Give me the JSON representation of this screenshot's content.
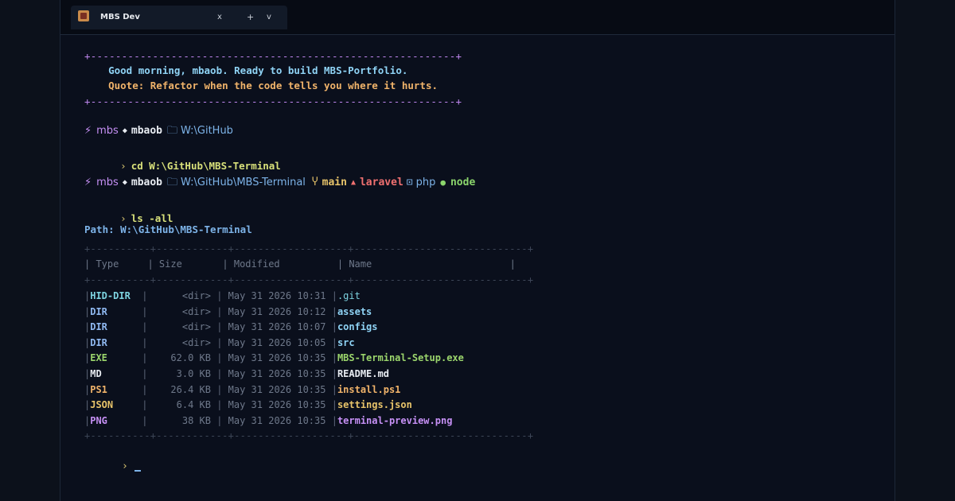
{
  "tab": {
    "title": "MBS Dev",
    "close": "x",
    "new_tab": "+",
    "dropdown": "v"
  },
  "banner": {
    "border": "+-----------------------------------------------------------+",
    "greeting": "    Good morning, mbaob. Ready to build MBS-Portfolio.",
    "quote": "    Quote: Refactor when the code tells you where it hurts."
  },
  "prompt1": {
    "distro": "mbs",
    "user": "mbaob",
    "path": "W:\\GitHub",
    "command": "cd W:\\GitHub\\MBS-Terminal"
  },
  "prompt2": {
    "distro": "mbs",
    "user": "mbaob",
    "path": "W:\\GitHub\\MBS-Terminal",
    "branch": "main",
    "framework": "laravel",
    "lang": "php",
    "runtime": "node",
    "command": "ls -all"
  },
  "listing": {
    "path_line": "Path: W:\\GitHub\\MBS-Terminal",
    "border": "+----------+------------+-------------------+-----------------------------+",
    "header": "| Type     | Size       | Modified          | Name                        |",
    "rows": [
      {
        "type": "HID-DIR",
        "size": "     <dir>",
        "modified": "May 31 2026 10:31",
        "name": ".git"
      },
      {
        "type": "DIR",
        "size": "     <dir>",
        "modified": "May 31 2026 10:12",
        "name": "assets"
      },
      {
        "type": "DIR",
        "size": "     <dir>",
        "modified": "May 31 2026 10:07",
        "name": "configs"
      },
      {
        "type": "DIR",
        "size": "     <dir>",
        "modified": "May 31 2026 10:05",
        "name": "src"
      },
      {
        "type": "EXE",
        "size": "   62.0 KB",
        "modified": "May 31 2026 10:35",
        "name": "MBS-Terminal-Setup.exe"
      },
      {
        "type": "MD",
        "size": "    3.0 KB",
        "modified": "May 31 2026 10:35",
        "name": "README.md"
      },
      {
        "type": "PS1",
        "size": "   26.4 KB",
        "modified": "May 31 2026 10:35",
        "name": "install.ps1"
      },
      {
        "type": "JSON",
        "size": "    6.4 KB",
        "modified": "May 31 2026 10:35",
        "name": "settings.json"
      },
      {
        "type": "PNG",
        "size": "     38 KB",
        "modified": "May 31 2026 10:35",
        "name": "terminal-preview.png"
      }
    ]
  },
  "icons": {
    "bolt": "lightning-icon",
    "diamond": "diamond-icon",
    "folder": "folder-icon",
    "git": "git-branch-icon",
    "laravel": "triangle-icon",
    "php": "elephant-icon",
    "node": "dot-icon"
  },
  "colors": {
    "background": "#0a0f1c",
    "accent_purple": "#c690f5",
    "accent_blue": "#7db3e8",
    "accent_orange": "#f0b36a",
    "accent_green": "#8bd56c",
    "accent_red": "#f07070",
    "accent_yellow": "#e8c46a"
  },
  "input_prompt": "›"
}
